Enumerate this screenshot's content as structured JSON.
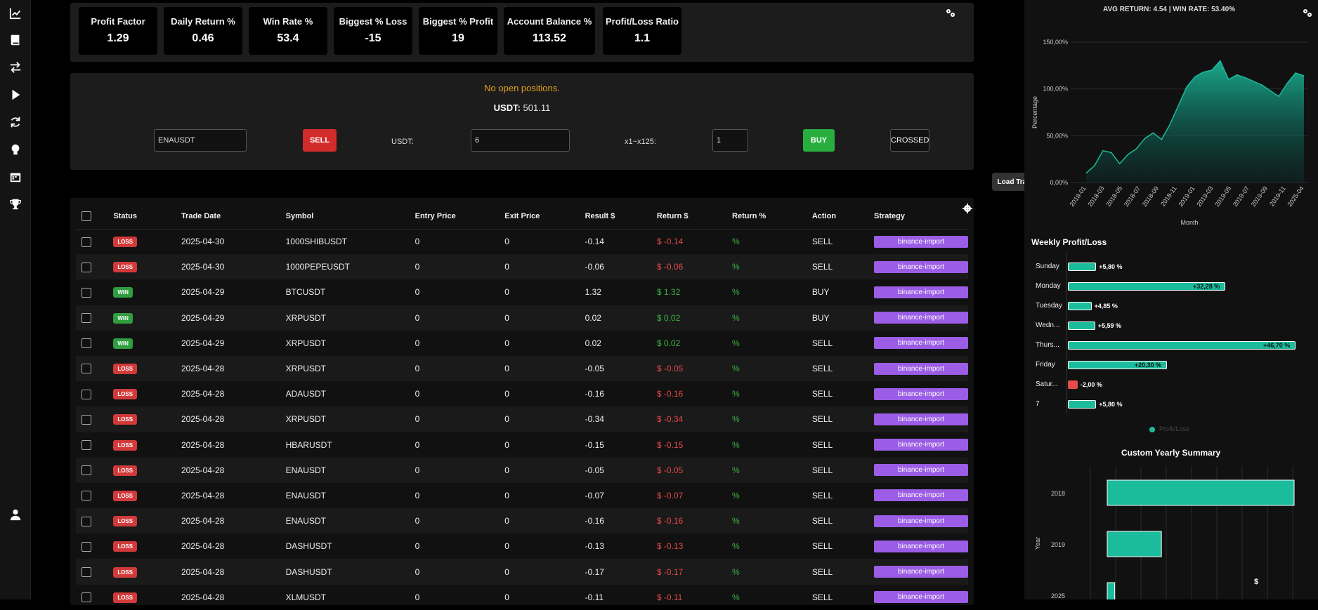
{
  "kpis": [
    {
      "label": "Profit Factor",
      "value": "1.29"
    },
    {
      "label": "Daily Return %",
      "value": "0.46"
    },
    {
      "label": "Win Rate %",
      "value": "53.4"
    },
    {
      "label": "Biggest % Loss",
      "value": "-15"
    },
    {
      "label": "Biggest % Profit",
      "value": "19"
    },
    {
      "label": "Account Balance %",
      "value": "113.52"
    },
    {
      "label": "Profit/Loss Ratio",
      "value": "1.1"
    }
  ],
  "order": {
    "no_positions": "No open positions.",
    "usdt_label": "USDT:",
    "usdt_value": "501.11",
    "symbol_value": "ENAUSDT",
    "sell_label": "SELL",
    "amount_label": "USDT:",
    "amount_value": "6",
    "leverage_label": "x1~x125:",
    "leverage_value": "1",
    "buy_label": "BUY",
    "margin_label": "CROSSED"
  },
  "load_trades_label": "Load Trades",
  "table": {
    "headers": [
      "Status",
      "Trade Date",
      "Symbol",
      "Entry Price",
      "Exit Price",
      "Result $",
      "Return $",
      "Return %",
      "Action",
      "Strategy"
    ],
    "rows": [
      {
        "status": "LOSS",
        "date": "2025-04-30",
        "symbol": "1000SHIBUSDT",
        "entry": "0",
        "exit": "0",
        "result": "-0.14",
        "ret": "$ -0.14",
        "retp": "%",
        "action": "SELL",
        "strategy": "binance-import"
      },
      {
        "status": "LOSS",
        "date": "2025-04-30",
        "symbol": "1000PEPEUSDT",
        "entry": "0",
        "exit": "0",
        "result": "-0.06",
        "ret": "$ -0.06",
        "retp": "%",
        "action": "SELL",
        "strategy": "binance-import"
      },
      {
        "status": "WIN",
        "date": "2025-04-29",
        "symbol": "BTCUSDT",
        "entry": "0",
        "exit": "0",
        "result": "1.32",
        "ret": "$ 1.32",
        "retp": "%",
        "action": "BUY",
        "strategy": "binance-import"
      },
      {
        "status": "WIN",
        "date": "2025-04-29",
        "symbol": "XRPUSDT",
        "entry": "0",
        "exit": "0",
        "result": "0.02",
        "ret": "$ 0.02",
        "retp": "%",
        "action": "BUY",
        "strategy": "binance-import"
      },
      {
        "status": "WIN",
        "date": "2025-04-29",
        "symbol": "XRPUSDT",
        "entry": "0",
        "exit": "0",
        "result": "0.02",
        "ret": "$ 0.02",
        "retp": "%",
        "action": "SELL",
        "strategy": "binance-import"
      },
      {
        "status": "LOSS",
        "date": "2025-04-28",
        "symbol": "XRPUSDT",
        "entry": "0",
        "exit": "0",
        "result": "-0.05",
        "ret": "$ -0.05",
        "retp": "%",
        "action": "SELL",
        "strategy": "binance-import"
      },
      {
        "status": "LOSS",
        "date": "2025-04-28",
        "symbol": "ADAUSDT",
        "entry": "0",
        "exit": "0",
        "result": "-0.16",
        "ret": "$ -0.16",
        "retp": "%",
        "action": "SELL",
        "strategy": "binance-import"
      },
      {
        "status": "LOSS",
        "date": "2025-04-28",
        "symbol": "XRPUSDT",
        "entry": "0",
        "exit": "0",
        "result": "-0.34",
        "ret": "$ -0.34",
        "retp": "%",
        "action": "SELL",
        "strategy": "binance-import"
      },
      {
        "status": "LOSS",
        "date": "2025-04-28",
        "symbol": "HBARUSDT",
        "entry": "0",
        "exit": "0",
        "result": "-0.15",
        "ret": "$ -0.15",
        "retp": "%",
        "action": "SELL",
        "strategy": "binance-import"
      },
      {
        "status": "LOSS",
        "date": "2025-04-28",
        "symbol": "ENAUSDT",
        "entry": "0",
        "exit": "0",
        "result": "-0.05",
        "ret": "$ -0.05",
        "retp": "%",
        "action": "SELL",
        "strategy": "binance-import"
      },
      {
        "status": "LOSS",
        "date": "2025-04-28",
        "symbol": "ENAUSDT",
        "entry": "0",
        "exit": "0",
        "result": "-0.07",
        "ret": "$ -0.07",
        "retp": "%",
        "action": "SELL",
        "strategy": "binance-import"
      },
      {
        "status": "LOSS",
        "date": "2025-04-28",
        "symbol": "ENAUSDT",
        "entry": "0",
        "exit": "0",
        "result": "-0.16",
        "ret": "$ -0.16",
        "retp": "%",
        "action": "SELL",
        "strategy": "binance-import"
      },
      {
        "status": "LOSS",
        "date": "2025-04-28",
        "symbol": "DASHUSDT",
        "entry": "0",
        "exit": "0",
        "result": "-0.13",
        "ret": "$ -0.13",
        "retp": "%",
        "action": "SELL",
        "strategy": "binance-import"
      },
      {
        "status": "LOSS",
        "date": "2025-04-28",
        "symbol": "DASHUSDT",
        "entry": "0",
        "exit": "0",
        "result": "-0.17",
        "ret": "$ -0.17",
        "retp": "%",
        "action": "SELL",
        "strategy": "binance-import"
      },
      {
        "status": "LOSS",
        "date": "2025-04-28",
        "symbol": "XLMUSDT",
        "entry": "0",
        "exit": "0",
        "result": "-0.11",
        "ret": "$ -0.11",
        "retp": "%",
        "action": "SELL",
        "strategy": "binance-import"
      }
    ]
  },
  "sidebar": {
    "icons": [
      "chart-line-icon",
      "book-icon",
      "exchange-icon",
      "play-icon",
      "sync-icon",
      "lightbulb-icon",
      "calendar-icon",
      "trophy-icon",
      "user-icon"
    ]
  },
  "colors": {
    "accent": "#1abc9c",
    "loss": "#d23a3a",
    "win": "#2e9e3e",
    "strategy": "#9b5de5",
    "warning": "#e0a020"
  },
  "chart_data": [
    {
      "type": "area",
      "title": "AVG RETURN: 4.54 | WIN RATE: 53.40%",
      "xlabel": "Month",
      "ylabel": "Percentage",
      "x_ticks": [
        "2018-01",
        "2018-03",
        "2018-05",
        "2018-07",
        "2018-09",
        "2018-11",
        "2019-01",
        "2019-03",
        "2019-05",
        "2019-07",
        "2019-09",
        "2019-11",
        "2025-04"
      ],
      "y_ticks": [
        "0,00%",
        "50,00%",
        "100,00%",
        "150,00%"
      ],
      "ylim": [
        0,
        150
      ],
      "values": [
        10,
        18,
        34,
        32,
        20,
        30,
        36,
        47,
        53,
        46,
        62,
        82,
        102,
        113,
        118,
        120,
        130,
        110,
        115,
        112,
        108,
        104,
        98,
        92,
        106,
        117,
        114
      ]
    },
    {
      "type": "bar",
      "orientation": "horizontal",
      "title": "Weekly Profit/Loss",
      "categories": [
        "Sunday",
        "Monday",
        "Tuesday",
        "Wedn...",
        "Thurs...",
        "Friday",
        "Satur...",
        "7"
      ],
      "values": [
        5.8,
        32.28,
        4.85,
        5.59,
        46.7,
        20.3,
        -2.0,
        5.8
      ],
      "value_labels": [
        "+5,80 %",
        "+32,28 %",
        "+4,85 %",
        "+5,59 %",
        "+46,70 %",
        "+20,30 %",
        "-2,00 %",
        "+5,80 %"
      ],
      "legend": "Profit/Loss"
    },
    {
      "type": "bar",
      "orientation": "horizontal",
      "title": "Custom Yearly Summary",
      "ylabel": "Year",
      "categories": [
        "2018",
        "2019",
        "2025"
      ],
      "values": [
        100,
        29,
        4
      ],
      "annotation": "$"
    }
  ]
}
